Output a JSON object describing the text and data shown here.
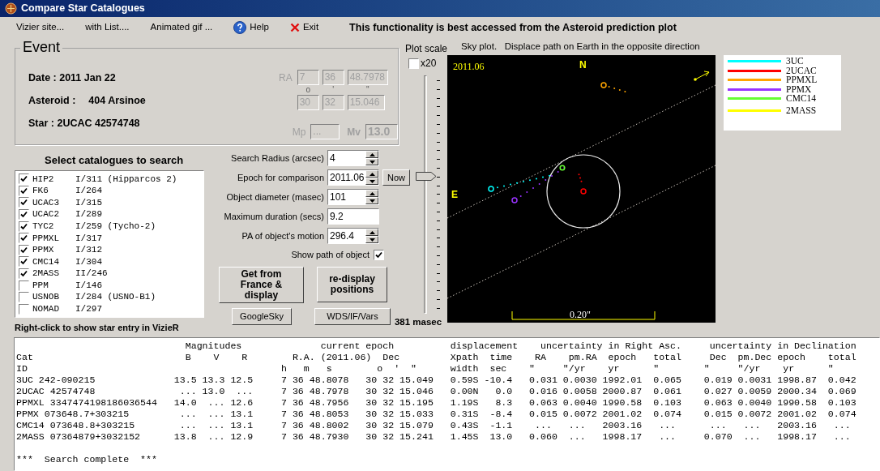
{
  "window": {
    "title": "Compare Star Catalogues"
  },
  "toolbar": {
    "items": [
      {
        "label": "Vizier site...",
        "kind": "plain"
      },
      {
        "label": "with List....",
        "kind": "plain"
      },
      {
        "label": "Animated gif ...",
        "kind": "plain"
      },
      {
        "label": "Help",
        "kind": "help"
      },
      {
        "label": "Exit",
        "kind": "exit"
      }
    ],
    "notice": "This functionality is best accessed from the Asteroid prediction plot"
  },
  "event": {
    "title": "Event",
    "date": "Date : 2011 Jan 22",
    "asteroid_label": "Asteroid :",
    "asteroid": "404 Arsinoe",
    "star": "Star : 2UCAC 42574748",
    "disabled": true,
    "ra_label": "RA",
    "ra": [
      "7",
      "36",
      "48.7978"
    ],
    "dec_marks": [
      "o",
      "'",
      "\""
    ],
    "dec": [
      "30",
      "32",
      "15.046"
    ],
    "mp_label": "Mp",
    "mp": "...",
    "mv_label": "Mv",
    "mv": "13.0"
  },
  "plot_scale": {
    "label": "Plot scale",
    "x20": {
      "label": "x20",
      "checked": false
    },
    "level": 0.58,
    "reading": "381 masec"
  },
  "catalogues": {
    "title": "Select catalogues to search",
    "items": [
      {
        "code": "HIP2",
        "ref": "I/311 (Hipparcos 2)",
        "checked": true
      },
      {
        "code": "FK6",
        "ref": "I/264",
        "checked": true
      },
      {
        "code": "UCAC3",
        "ref": "I/315",
        "checked": true
      },
      {
        "code": "UCAC2",
        "ref": "I/289",
        "checked": true
      },
      {
        "code": "TYC2",
        "ref": "I/259 (Tycho-2)",
        "checked": true
      },
      {
        "code": "PPMXL",
        "ref": "I/317",
        "checked": true
      },
      {
        "code": "PPMX",
        "ref": "I/312",
        "checked": true
      },
      {
        "code": "CMC14",
        "ref": "I/304",
        "checked": true
      },
      {
        "code": "2MASS",
        "ref": "II/246",
        "checked": true
      },
      {
        "code": "PPM",
        "ref": "I/146",
        "checked": false
      },
      {
        "code": "USNOB",
        "ref": "I/284 (USNO-B1)",
        "checked": false
      },
      {
        "code": "NOMAD",
        "ref": "I/297",
        "checked": false
      }
    ],
    "hint": "Right-click to show star entry in VizieR"
  },
  "form": {
    "fields": [
      {
        "label": "Search Radius (arcsec)",
        "value": "4",
        "kind": "spinner"
      },
      {
        "label": "Epoch for comparison",
        "value": "2011.06",
        "kind": "spinner",
        "button": "Now"
      },
      {
        "label": "Object diameter (masec)",
        "value": "101",
        "kind": "spinner"
      },
      {
        "label": "Maximum duration (secs)",
        "value": "9.2",
        "kind": "text"
      },
      {
        "label": "PA of object's motion",
        "value": "296.4",
        "kind": "spinner"
      }
    ],
    "show_path": {
      "label": "Show path of object",
      "checked": true
    },
    "buttons": [
      "Get from France & display",
      "re-display positions"
    ],
    "small_buttons": [
      "GoogleSky",
      "WDS/IF/Vars"
    ]
  },
  "sky_plot": {
    "caption": "Sky plot.   Displace path on Earth in the opposite direction",
    "epoch": "2011.06",
    "north": "N",
    "east": "E",
    "scale": "0.20\"",
    "legend": [
      {
        "name": "3UC",
        "color": "#00ffff"
      },
      {
        "name": "2UCAC",
        "color": "#ff0000"
      },
      {
        "name": "PPMXL",
        "color": "#ffa500"
      },
      {
        "name": "PPMX",
        "color": "#9933ff"
      },
      {
        "name": "CMC14",
        "color": "#66ff33"
      },
      {
        "name": "2MASS",
        "color": "#ffff00"
      }
    ]
  },
  "output": {
    "lines": [
      "                              Magnitudes              current epoch          displacement    uncertainty in Right Asc.     uncertainty in Declination",
      "Cat                           B    V    R        R.A. (2011.06)  Dec         Xpath  time    RA    pm.RA  epoch   total     Dec  pm.Dec epoch    total",
      "ID                                             h   m   s        o  '  \"      width  sec    \"     \"/yr    yr      \"        \"     \"/yr    yr      \"",
      "3UC 242-090215              13.5 13.3 12.5     7 36 48.8078   30 32 15.049   0.59S -10.4   0.031 0.0030 1992.01  0.065    0.019 0.0031 1998.87  0.042",
      "2UCAC 42574748               ... 13.0  ...     7 36 48.7978   30 32 15.046   0.00N   0.0   0.016 0.0058 2000.87  0.061    0.027 0.0059 2000.34  0.069",
      "PPMXL 3347474198186036544   14.0  ... 12.6     7 36 48.7956   30 32 15.195   1.19S   8.3   0.063 0.0040 1990.58  0.103    0.063 0.0040 1990.58  0.103",
      "PPMX 073648.7+303215         ...  ... 13.1     7 36 48.8053   30 32 15.033   0.31S  -8.4   0.015 0.0072 2001.02  0.074    0.015 0.0072 2001.02  0.074",
      "CMC14 073648.8+303215        ...  ... 13.1     7 36 48.8002   30 32 15.079   0.43S  -1.1    ...   ...   2003.16   ...      ...   ...   2003.16   ...",
      "2MASS 07364879+3032152      13.8  ... 12.9     7 36 48.7930   30 32 15.241   1.45S  13.0   0.060  ...   1998.17   ...     0.070  ...   1998.17   ..."
    ],
    "status": "***  Search complete  ***"
  }
}
